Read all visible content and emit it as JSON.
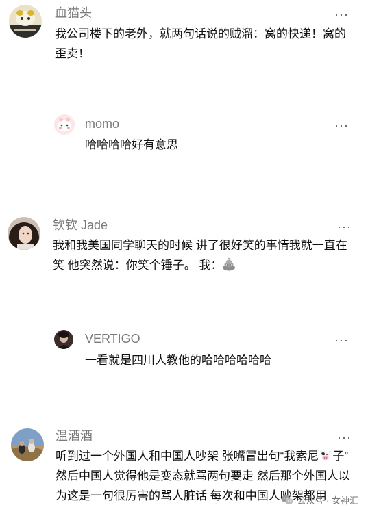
{
  "comments": [
    {
      "username": "血猫头",
      "text": "我公司楼下的老外，就两句话说的贼溜：窝的快递！窝的歪卖！",
      "more": "···"
    },
    {
      "username": "momo",
      "text": "哈哈哈哈好有意思",
      "more": "···"
    },
    {
      "username": "钦钦 Jade",
      "text": "我和我美国同学聊天的时候 讲了很好笑的事情我就一直在笑 他突然说：你笑个锤子。 我：",
      "more": "···"
    },
    {
      "username": "VERTIGO",
      "text": "一看就是四川人教他的哈哈哈哈哈哈",
      "more": "···"
    },
    {
      "username": "温酒酒",
      "text_a": "听到过一个外国人和中国人吵架 张嘴冒出句“我索尼",
      "text_b": "子” 然后中国人觉得他是变态就骂两句要走 然后那个外国人以为这是一句很厉害的骂人脏话 每次和中国人吵架都用",
      "more": "···"
    }
  ],
  "watermark": {
    "text": "公众号 · 女神汇",
    "icon": "wechat-icon"
  }
}
